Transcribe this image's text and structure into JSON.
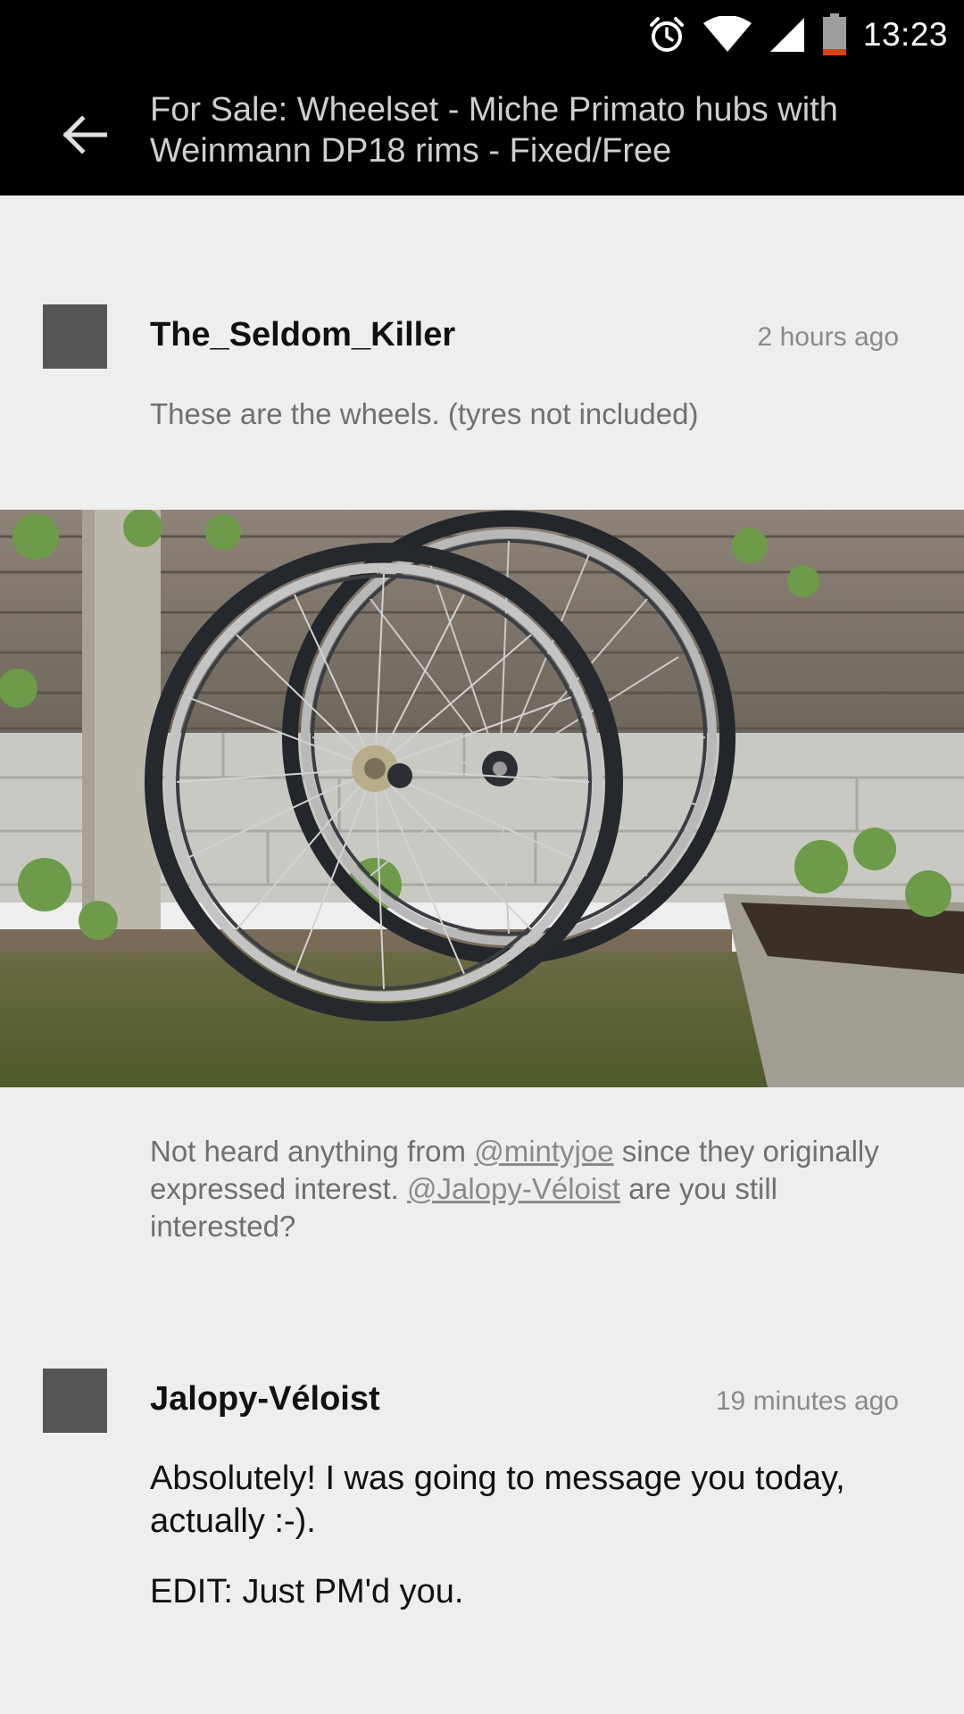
{
  "status_bar": {
    "time": "13:23",
    "icons": [
      "alarm-icon",
      "wifi-icon",
      "signal-icon",
      "battery-icon"
    ]
  },
  "app_bar": {
    "back_icon": "arrow-left-icon",
    "title": "For Sale: Wheelset - Miche Primato hubs with Weinmann DP18 rims - Fixed/Free"
  },
  "posts": [
    {
      "author": "The_Seldom_Killer",
      "time": "2 hours ago",
      "text": "These are the wheels. (tyres not included)",
      "image_alt": "Two bicycle wheels leaning against a wooden fence",
      "follow_up": {
        "part1": "Not heard anything from ",
        "mention1": "@mintyjoe",
        "part2": " since they originally expressed interest. ",
        "mention2": "@Jalopy-Véloist",
        "part3": " are you still interested?"
      }
    },
    {
      "author": "Jalopy-Véloist",
      "time": "19 minutes ago",
      "line1": "Absolutely! I was going to message you today, actually :-).",
      "line2": "EDIT: Just PM'd you."
    }
  ],
  "colors": {
    "background": "#eeeeee",
    "bar": "#000000",
    "avatar": "#555555",
    "title_text": "#cfcfcf"
  }
}
